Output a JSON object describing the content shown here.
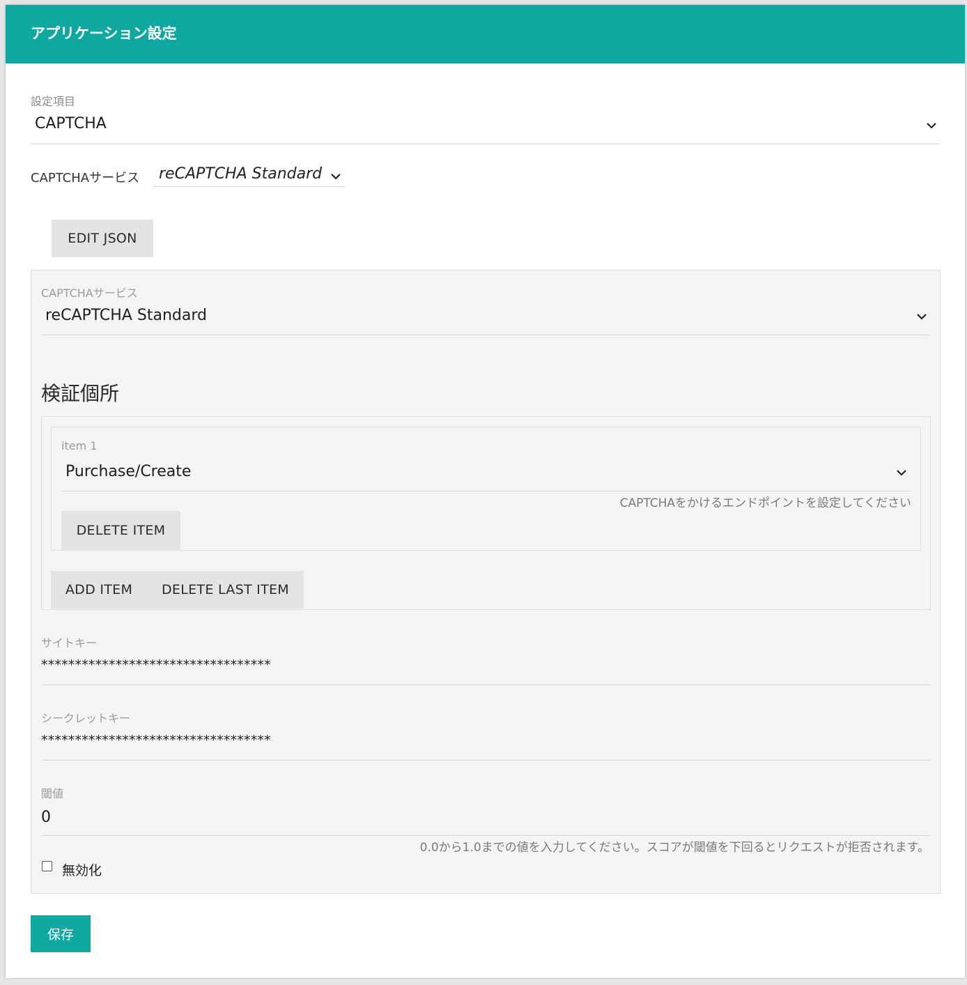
{
  "header": {
    "title": "アプリケーション設定"
  },
  "setting_select": {
    "label": "設定項目",
    "value": "CAPTCHA"
  },
  "captcha_service_inline": {
    "label": "CAPTCHAサービス",
    "value": "reCAPTCHA Standard"
  },
  "edit_json_label": "EDIT JSON",
  "form": {
    "captcha_service": {
      "label": "CAPTCHAサービス",
      "value": "reCAPTCHA Standard"
    },
    "verification": {
      "title": "検証個所",
      "items": [
        {
          "label": "item 1",
          "value": "Purchase/Create",
          "help": "CAPTCHAをかけるエンドポイントを設定してください",
          "delete_label": "DELETE ITEM"
        }
      ],
      "add_label": "ADD ITEM",
      "delete_last_label": "DELETE LAST ITEM"
    },
    "site_key": {
      "label": "サイトキー",
      "value": "**********************************"
    },
    "secret_key": {
      "label": "シークレットキー",
      "value": "**********************************"
    },
    "threshold": {
      "label": "閾値",
      "value": "0",
      "help": "0.0から1.0までの値を入力してください。スコアが閾値を下回るとリクエストが拒否されます。"
    },
    "disable": {
      "label": "無効化",
      "checked": false
    }
  },
  "save_label": "保存",
  "colors": {
    "accent": "#0ea8a0"
  },
  "icons": {
    "dropdown": "chevron-down-icon"
  }
}
